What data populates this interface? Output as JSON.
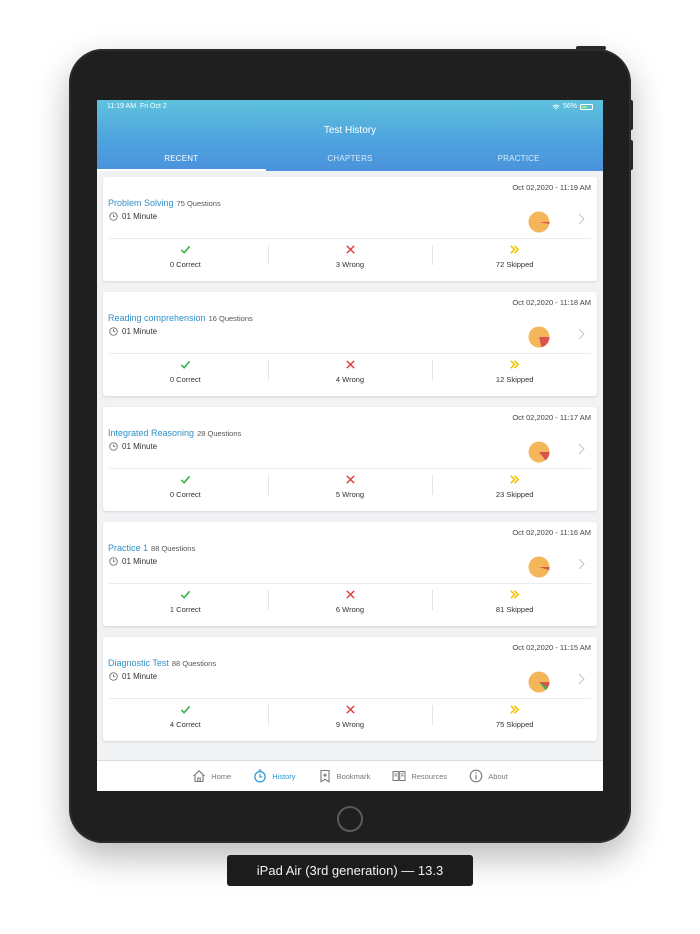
{
  "status_bar": {
    "time": "11:19 AM",
    "date": "Fri Oct 2",
    "battery": "56%"
  },
  "header": {
    "title": "Test History"
  },
  "tabs": [
    {
      "label": "RECENT",
      "active": true
    },
    {
      "label": "CHAPTERS",
      "active": false
    },
    {
      "label": "PRACTICE",
      "active": false
    }
  ],
  "cards": [
    {
      "title": "Problem Solving",
      "questions": "75 Questions",
      "duration": "01 Minute",
      "datetime": "Oct 02,2020 - 11:19 AM",
      "correct": "0 Correct",
      "wrong": "3 Wrong",
      "skipped": "72 Skipped"
    },
    {
      "title": "Reading comprehension",
      "questions": "16 Questions",
      "duration": "01 Minute",
      "datetime": "Oct 02,2020 - 11:18 AM",
      "correct": "0 Correct",
      "wrong": "4 Wrong",
      "skipped": "12 Skipped"
    },
    {
      "title": "Integrated Reasoning",
      "questions": "28 Questions",
      "duration": "01 Minute",
      "datetime": "Oct 02,2020 - 11:17 AM",
      "correct": "0 Correct",
      "wrong": "5 Wrong",
      "skipped": "23 Skipped"
    },
    {
      "title": "Practice 1",
      "questions": "88 Questions",
      "duration": "01 Minute",
      "datetime": "Oct 02,2020 - 11:16 AM",
      "correct": "1 Correct",
      "wrong": "6 Wrong",
      "skipped": "81 Skipped"
    },
    {
      "title": "Diagnostic Test",
      "questions": "88 Questions",
      "duration": "01 Minute",
      "datetime": "Oct 02,2020 - 11:15 AM",
      "correct": "4 Correct",
      "wrong": "9 Wrong",
      "skipped": "75 Skipped"
    }
  ],
  "tabbar": [
    {
      "label": "Home",
      "icon": "home-icon",
      "active": false
    },
    {
      "label": "History",
      "icon": "history-icon",
      "active": true
    },
    {
      "label": "Bookmark",
      "icon": "bookmark-icon",
      "active": false
    },
    {
      "label": "Resources",
      "icon": "resources-icon",
      "active": false
    },
    {
      "label": "About",
      "icon": "about-icon",
      "active": false
    }
  ],
  "caption": "iPad Air (3rd generation) — 13.3",
  "colors": {
    "accent": "#2f9bd8",
    "correct": "#3db54a",
    "wrong": "#e43b3b",
    "skipped": "#f2c200",
    "pie_base": "#f5b65a",
    "pie_wrong": "#d9534f",
    "pie_correct": "#3db54a"
  }
}
